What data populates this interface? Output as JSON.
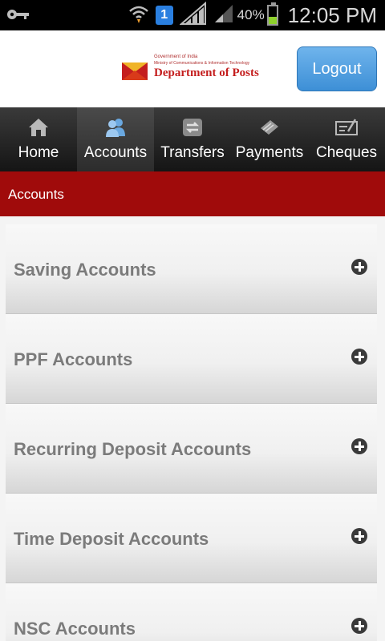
{
  "status_bar": {
    "key_icon": "key-icon",
    "wifi_icon": "wifi-icon",
    "notification_count": "1",
    "signal_icon": "signal-icon",
    "battery_percent": "40%",
    "battery_level": 0.4,
    "time": "12:05 PM"
  },
  "header": {
    "logo": {
      "line1": "Government of India",
      "line2": "Ministry of Communications & Information Technology",
      "name": "Department of Posts"
    },
    "logout_label": "Logout"
  },
  "nav": {
    "items": [
      {
        "label": "Home",
        "icon": "home-icon",
        "active": false
      },
      {
        "label": "Accounts",
        "icon": "users-icon",
        "active": true
      },
      {
        "label": "Transfers",
        "icon": "transfer-icon",
        "active": false
      },
      {
        "label": "Payments",
        "icon": "payment-icon",
        "active": false
      },
      {
        "label": "Cheques",
        "icon": "cheque-icon",
        "active": false
      }
    ]
  },
  "section": {
    "title": "Accounts"
  },
  "accounts": {
    "items": [
      {
        "label": "Saving Accounts"
      },
      {
        "label": "PPF Accounts"
      },
      {
        "label": "Recurring Deposit Accounts"
      },
      {
        "label": "Time Deposit Accounts"
      },
      {
        "label": "NSC Accounts"
      }
    ]
  },
  "colors": {
    "accent_red": "#a00b0b",
    "logout_blue": "#3d8fd6",
    "battery_green": "#8ed12c"
  }
}
